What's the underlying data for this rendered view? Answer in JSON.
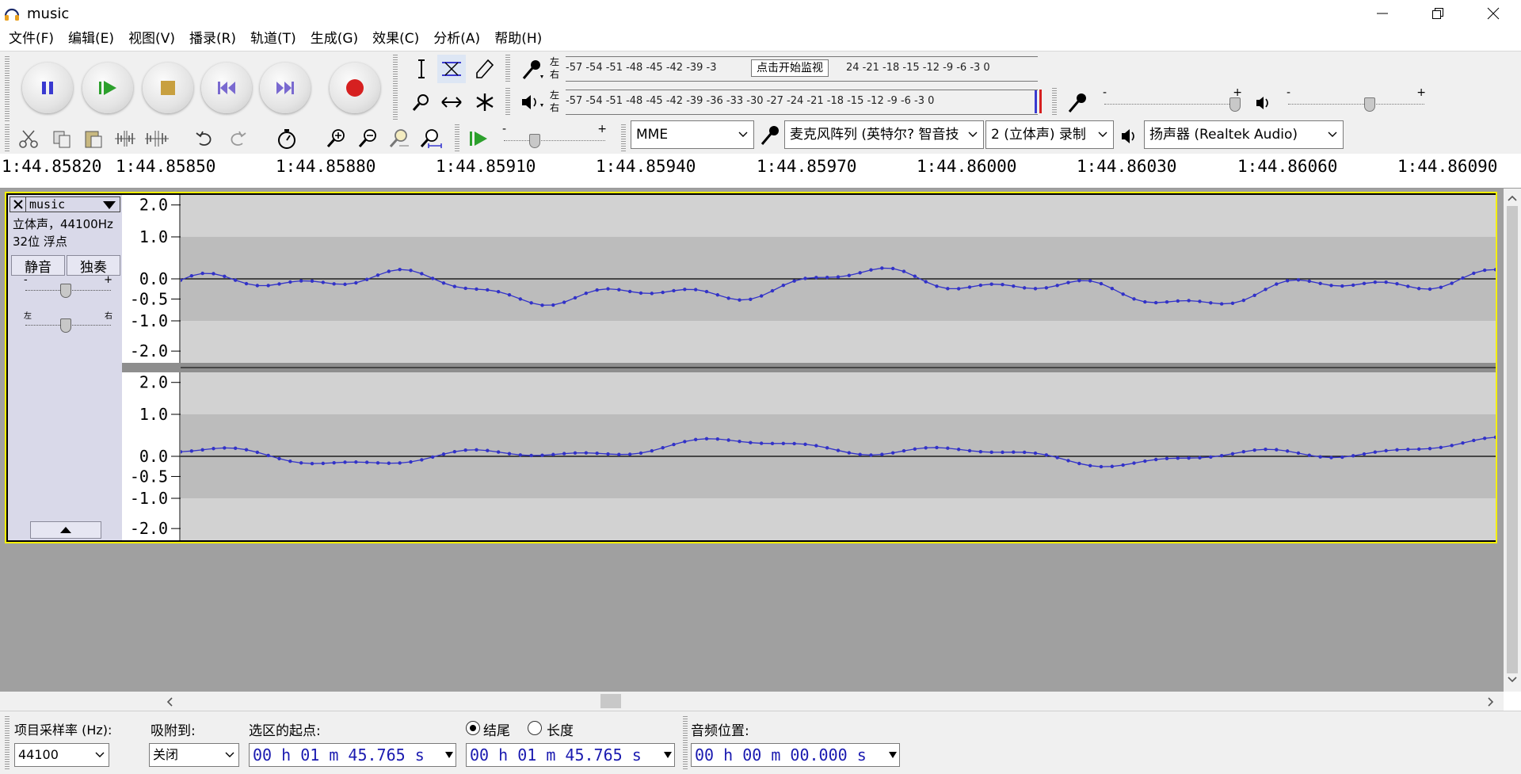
{
  "window": {
    "title": "music"
  },
  "menu": [
    "文件(F)",
    "编辑(E)",
    "视图(V)",
    "播录(R)",
    "轨道(T)",
    "生成(G)",
    "效果(C)",
    "分析(A)",
    "帮助(H)"
  ],
  "meters": {
    "record_lr": [
      "左",
      "右"
    ],
    "play_lr": [
      "左",
      "右"
    ],
    "record_scale": "-57 -54 -51 -48 -45 -42 -39 -3",
    "record_scale_tail": "24 -21 -18 -15 -12  -9  -6  -3  0",
    "monitor_tooltip": "点击开始监视",
    "play_scale": "-57 -54 -51 -48 -45 -42 -39 -36 -33 -30 -27 -24 -21 -18 -15 -12  -9  -6  -3  0",
    "slider_minus": "-",
    "slider_plus": "+"
  },
  "devices": {
    "host": "MME",
    "mic": "麦克风阵列 (英特尔? 智音技",
    "channels": "2 (立体声) 录制",
    "speaker": "扬声器 (Realtek Audio)"
  },
  "ruler": [
    "1:44.85820",
    "1:44.85850",
    "1:44.85880",
    "1:44.85910",
    "1:44.85940",
    "1:44.85970",
    "1:44.86000",
    "1:44.86030",
    "1:44.86060",
    "1:44.86090"
  ],
  "track": {
    "name": "music",
    "info1": "立体声，44100Hz",
    "info2": "32位 浮点",
    "mute": "静音",
    "solo": "独奏",
    "gain_minus": "-",
    "gain_plus": "+",
    "pan_left": "左",
    "pan_right": "右",
    "vlabels": [
      "2.0",
      "1.0",
      "0.0",
      "-0.5",
      "-1.0",
      "-2.0"
    ]
  },
  "selection": {
    "rate_label": "项目采样率 (Hz):",
    "rate_value": "44100",
    "snap_label": "吸附到:",
    "snap_value": "关闭",
    "start_label": "选区的起点:",
    "end_label": "结尾",
    "length_label": "长度",
    "audio_pos_label": "音频位置:",
    "start_time": "00 h 01 m 45.765 s",
    "end_time": "00 h 01 m 45.765 s",
    "audio_time": "00 h 00 m 00.000 s"
  },
  "colors": {
    "waveform": "#3232c8",
    "selected_border": "#f5f000",
    "track_panel": "#d9d9e9",
    "record_red": "#d62020",
    "play_green": "#2ca02c"
  }
}
